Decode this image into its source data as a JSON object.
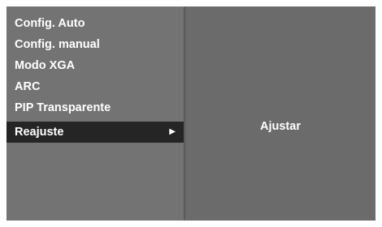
{
  "menu": {
    "items": [
      {
        "label": "Config. Auto"
      },
      {
        "label": "Config. manual"
      },
      {
        "label": "Modo XGA"
      },
      {
        "label": "ARC"
      },
      {
        "label": "PIP Transparente"
      },
      {
        "label": "Reajuste",
        "selected": true
      }
    ],
    "arrow_icon": "triangle-right-icon"
  },
  "detail": {
    "value": "Ajustar"
  },
  "colors": {
    "panel_background": "#737373",
    "detail_background": "#6b6b6b",
    "selected_row": "#252525",
    "text": "#ffffff"
  }
}
